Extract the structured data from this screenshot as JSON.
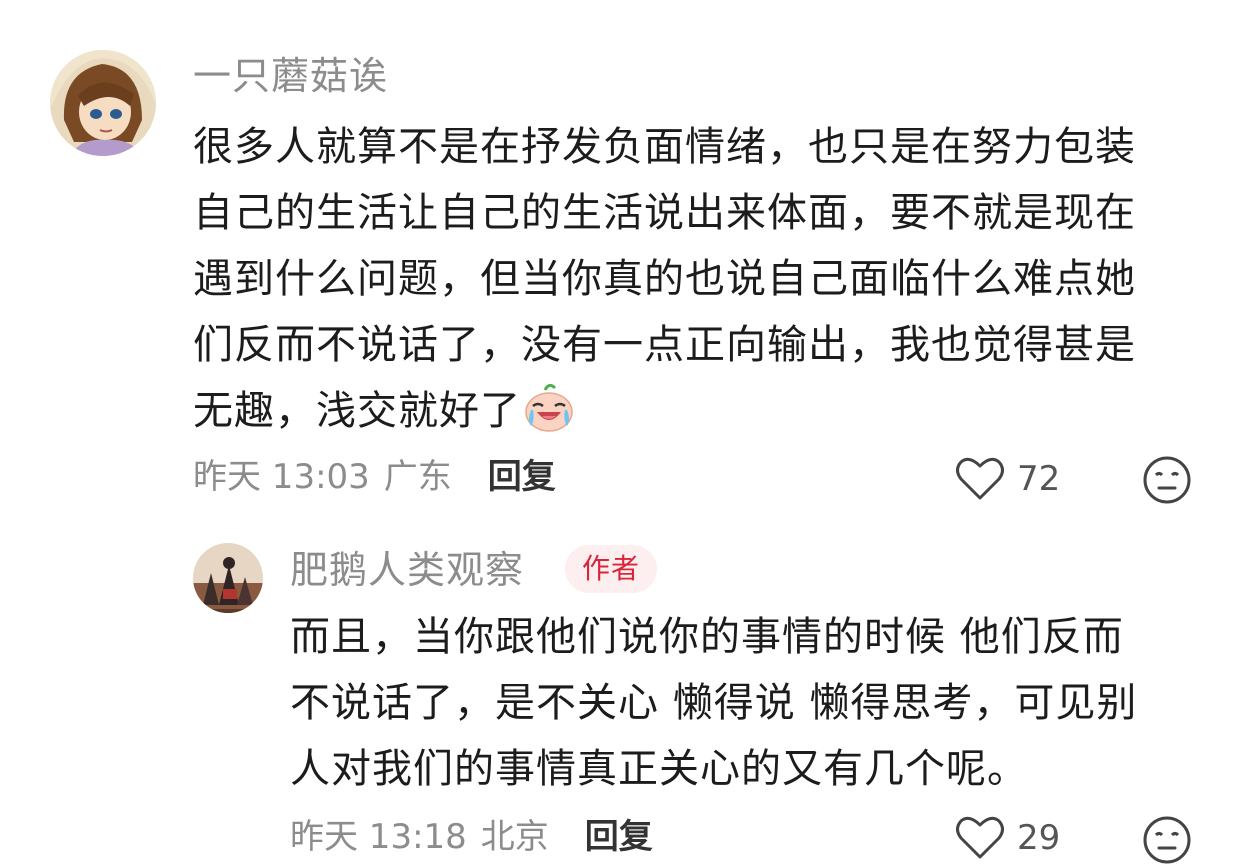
{
  "comment": {
    "username": "一只蘑菇诶",
    "lines": [
      "很多人就算不是在抒发负面情绪，也只是在努力包装",
      "自己的生活让自己的生活说出来体面，要不就是现在",
      "遇到什么问题，但当你真的也说自己面临什么难点她",
      "们反而不说话了，没有一点正向输出，我也觉得甚是",
      "无趣，浅交就好了"
    ],
    "emoji": "crying-face-emoji",
    "time": "昨天 13:03",
    "location": "广东",
    "reply_label": "回复",
    "likes": "72"
  },
  "reply": {
    "username": "肥鹅人类观察",
    "badge": "作者",
    "lines": [
      "而且，当你跟他们说你的事情的时候 他们反而",
      "不说话了，是不关心 懒得说 懒得思考，可见别",
      "人对我们的事情真正关心的又有几个呢。"
    ],
    "time": "昨天 13:18",
    "location": "北京",
    "reply_label": "回复",
    "likes": "29"
  },
  "colors": {
    "username": "#8c8c8c",
    "badge_text": "#d9253a",
    "badge_bg": "#fdeef0",
    "body_text": "#1c1c1c"
  },
  "icons": [
    "heart-outline-icon",
    "meh-face-icon",
    "crying-face-emoji"
  ]
}
